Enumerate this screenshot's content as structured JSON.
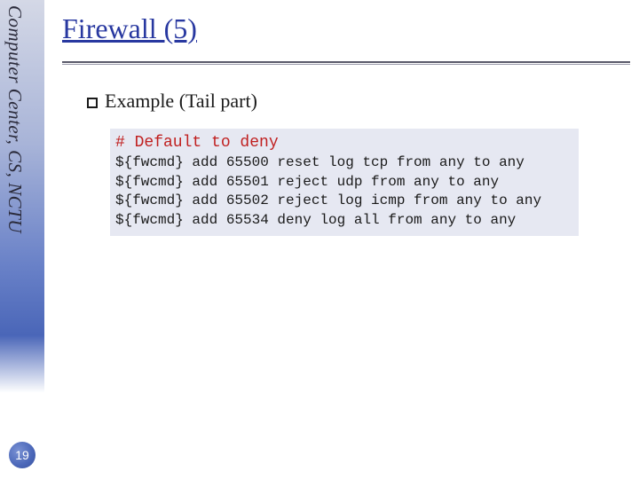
{
  "sidebar": {
    "label": "Computer Center, CS, NCTU"
  },
  "page_number": "19",
  "title": "Firewall (5)",
  "subtitle": "Example (Tail part)",
  "code": {
    "comment": "# Default to deny",
    "lines": [
      "${fwcmd} add 65500 reset log tcp from any to any",
      "${fwcmd} add 65501 reject udp from any to any",
      "${fwcmd} add 65502 reject log icmp from any to any",
      "${fwcmd} add 65534 deny log all from any to any"
    ]
  }
}
